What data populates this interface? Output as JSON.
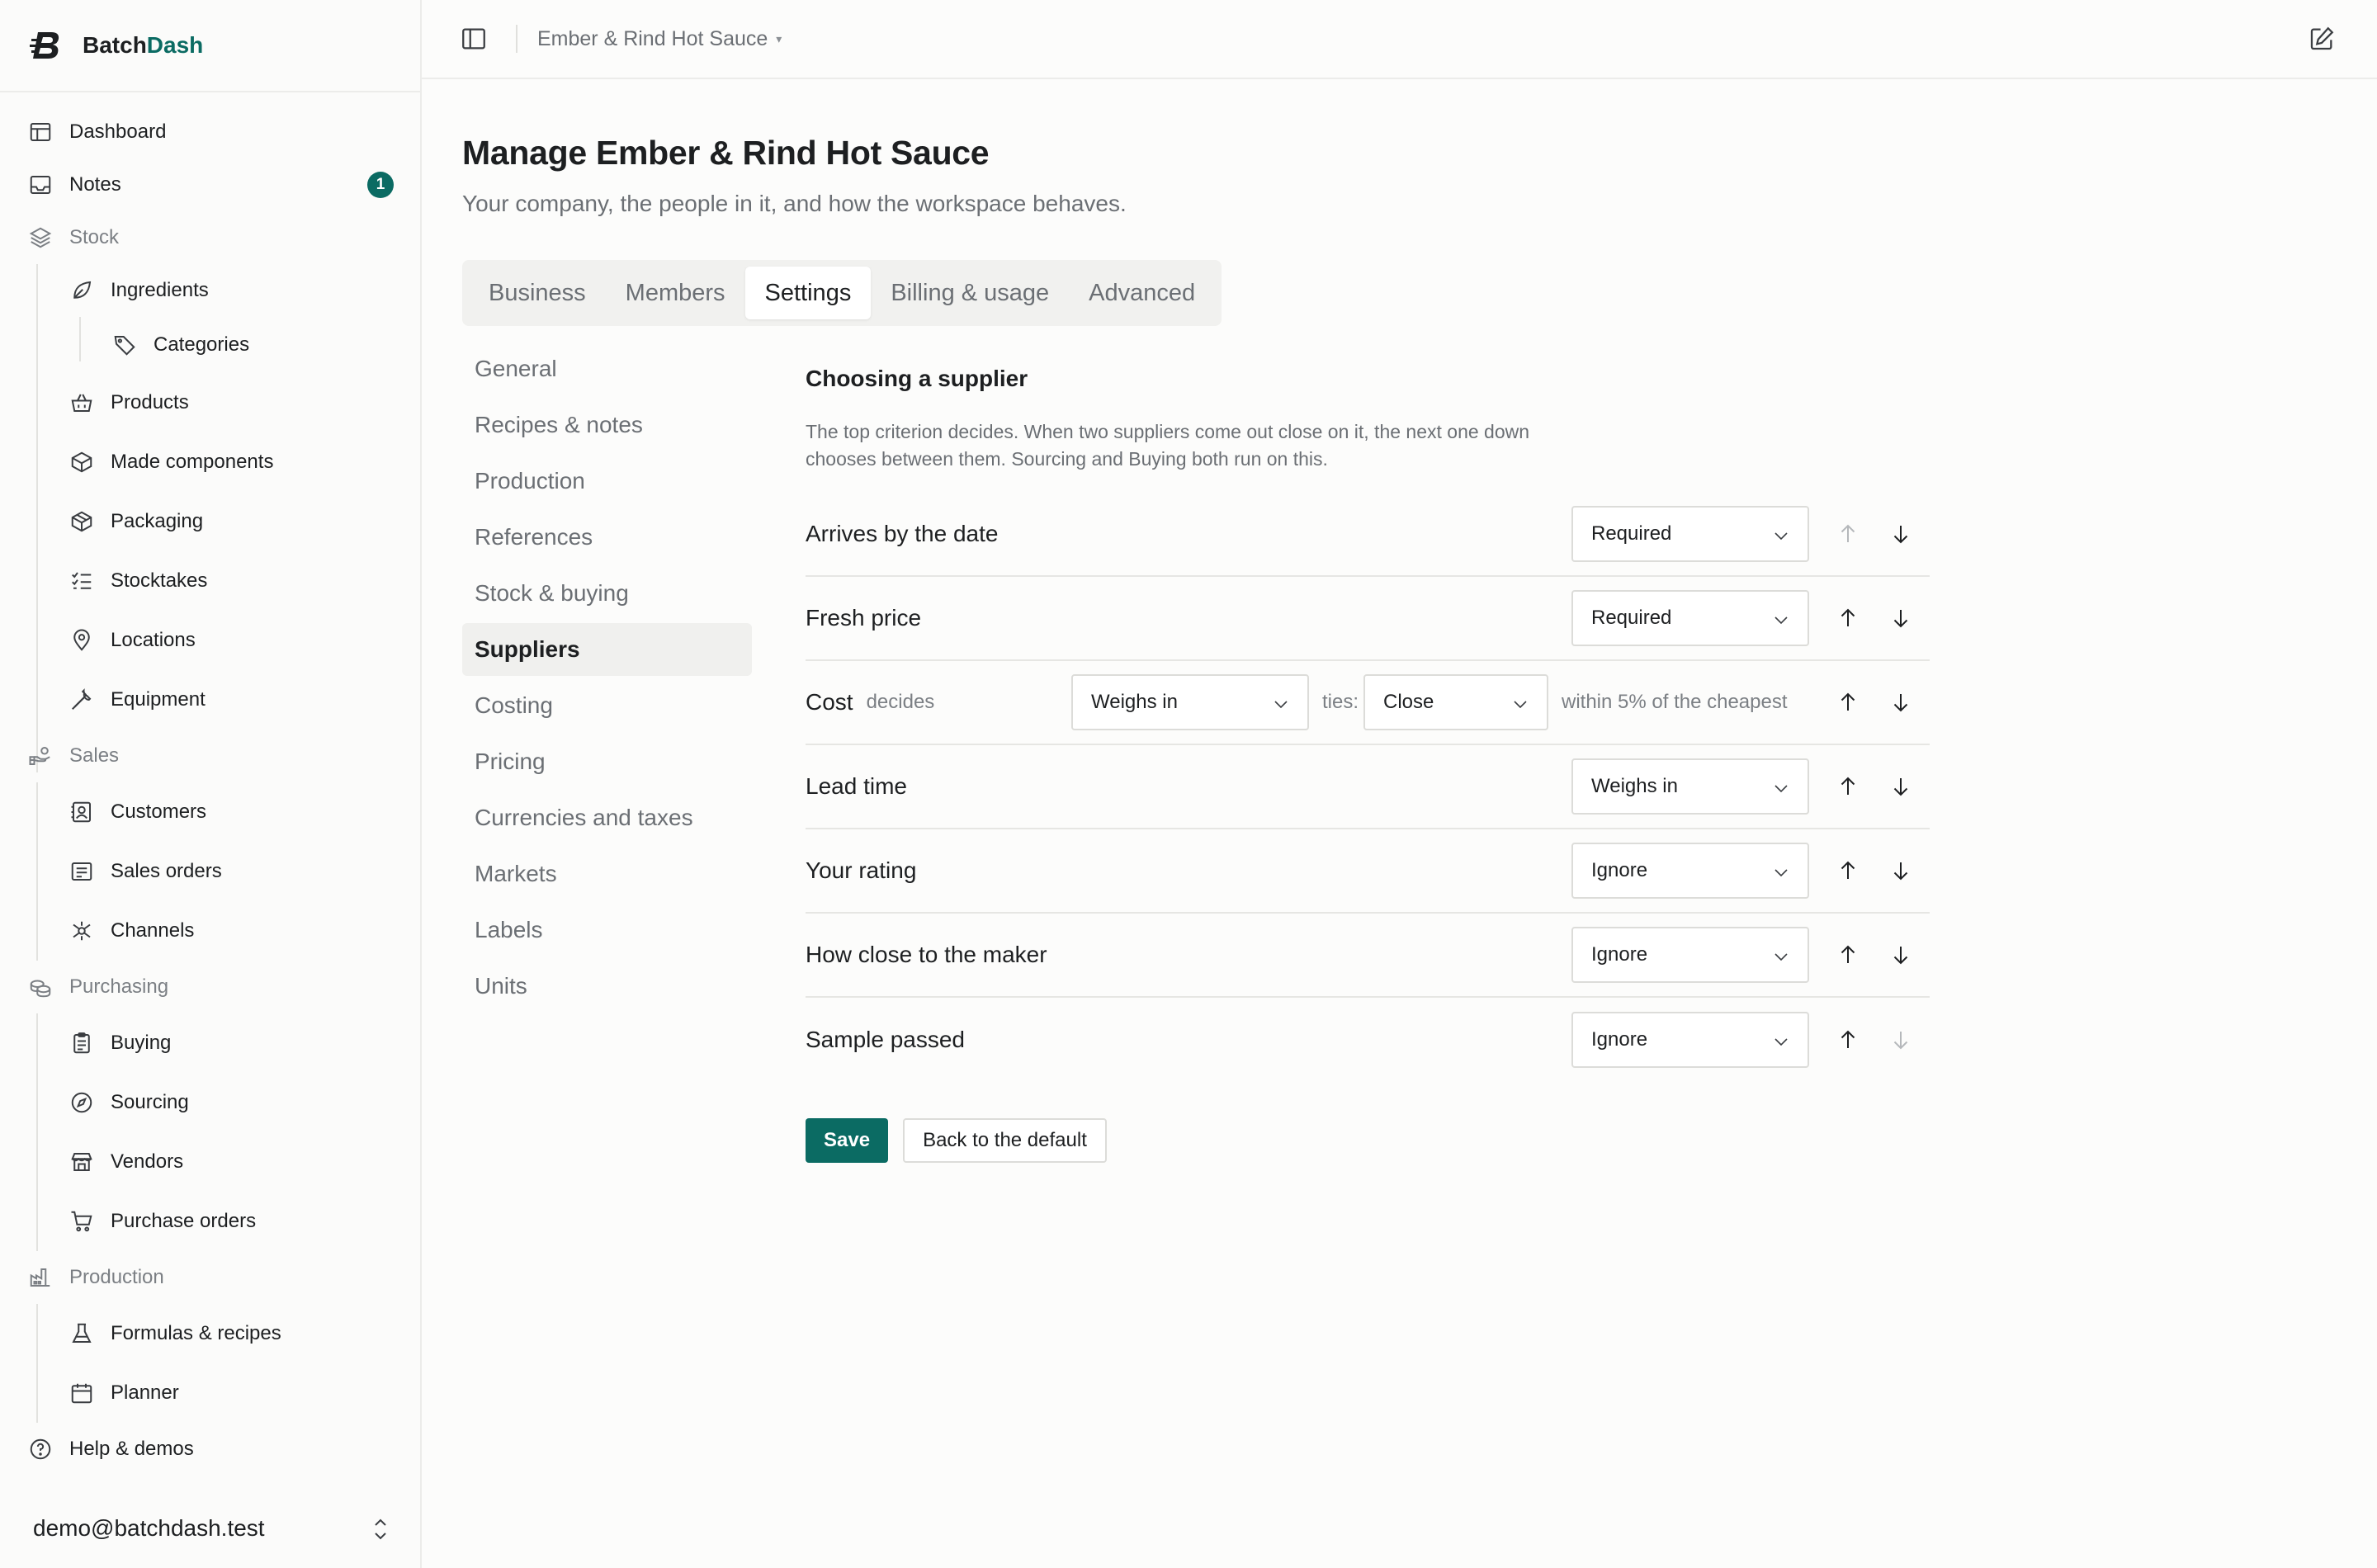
{
  "brand": {
    "name_part1": "Batch",
    "name_part2": "Dash",
    "accent_color": "#0b6b63"
  },
  "sidebar": {
    "dashboard": {
      "label": "Dashboard",
      "icon": "layout-icon"
    },
    "notes": {
      "label": "Notes",
      "icon": "inbox-icon",
      "badge": "1"
    },
    "stock": {
      "label": "Stock",
      "icon": "layers-icon",
      "items": [
        {
          "label": "Ingredients",
          "icon": "leaf-icon"
        },
        {
          "label": "Categories",
          "icon": "tag-icon"
        },
        {
          "label": "Products",
          "icon": "basket-icon"
        },
        {
          "label": "Made components",
          "icon": "box-icon"
        },
        {
          "label": "Packaging",
          "icon": "package-icon"
        },
        {
          "label": "Stocktakes",
          "icon": "list-check-icon"
        },
        {
          "label": "Locations",
          "icon": "map-pin-icon"
        },
        {
          "label": "Equipment",
          "icon": "wrench-icon"
        }
      ]
    },
    "sales": {
      "label": "Sales",
      "icon": "hand-coins-icon",
      "items": [
        {
          "label": "Customers",
          "icon": "contact-icon"
        },
        {
          "label": "Sales orders",
          "icon": "receipt-icon"
        },
        {
          "label": "Channels",
          "icon": "network-icon"
        }
      ]
    },
    "purchasing": {
      "label": "Purchasing",
      "icon": "coins-icon",
      "items": [
        {
          "label": "Buying",
          "icon": "clipboard-icon"
        },
        {
          "label": "Sourcing",
          "icon": "compass-icon"
        },
        {
          "label": "Vendors",
          "icon": "store-icon"
        },
        {
          "label": "Purchase orders",
          "icon": "cart-icon"
        }
      ]
    },
    "production": {
      "label": "Production",
      "icon": "factory-icon",
      "items": [
        {
          "label": "Formulas & recipes",
          "icon": "flask-icon"
        },
        {
          "label": "Planner",
          "icon": "calendar-icon"
        }
      ]
    },
    "help": {
      "label": "Help & demos",
      "icon": "help-circle-icon"
    },
    "user_email": "demo@batchdash.test"
  },
  "topbar": {
    "breadcrumb": "Ember & Rind Hot Sauce"
  },
  "page": {
    "title": "Manage Ember & Rind Hot Sauce",
    "subtitle": "Your company, the people in it, and how the workspace behaves."
  },
  "tabs": [
    {
      "label": "Business",
      "active": false
    },
    {
      "label": "Members",
      "active": false
    },
    {
      "label": "Settings",
      "active": true
    },
    {
      "label": "Billing & usage",
      "active": false
    },
    {
      "label": "Advanced",
      "active": false
    }
  ],
  "settings_nav": [
    "General",
    "Recipes & notes",
    "Production",
    "References",
    "Stock & buying",
    "Suppliers",
    "Costing",
    "Pricing",
    "Currencies and taxes",
    "Markets",
    "Labels",
    "Units"
  ],
  "settings_nav_active": "Suppliers",
  "section": {
    "heading": "Choosing a supplier",
    "description": "The top criterion decides. When two suppliers come out close on it, the next one down chooses between them. Sourcing and Buying both run on this."
  },
  "criteria": [
    {
      "label": "Arrives by the date",
      "mode": "Required",
      "up_disabled": true,
      "down_disabled": false
    },
    {
      "label": "Fresh price",
      "mode": "Required",
      "up_disabled": false,
      "down_disabled": false
    },
    {
      "label": "Cost",
      "note": "decides",
      "mode": "Weighs in",
      "ties_label": "ties:",
      "ties_mode": "Close",
      "within": "within 5% of the cheapest",
      "up_disabled": false,
      "down_disabled": false
    },
    {
      "label": "Lead time",
      "mode": "Weighs in",
      "up_disabled": false,
      "down_disabled": false
    },
    {
      "label": "Your rating",
      "mode": "Ignore",
      "up_disabled": false,
      "down_disabled": false
    },
    {
      "label": "How close to the maker",
      "mode": "Ignore",
      "up_disabled": false,
      "down_disabled": false
    },
    {
      "label": "Sample passed",
      "mode": "Ignore",
      "up_disabled": false,
      "down_disabled": true
    }
  ],
  "actions": {
    "save": "Save",
    "reset": "Back to the default"
  }
}
